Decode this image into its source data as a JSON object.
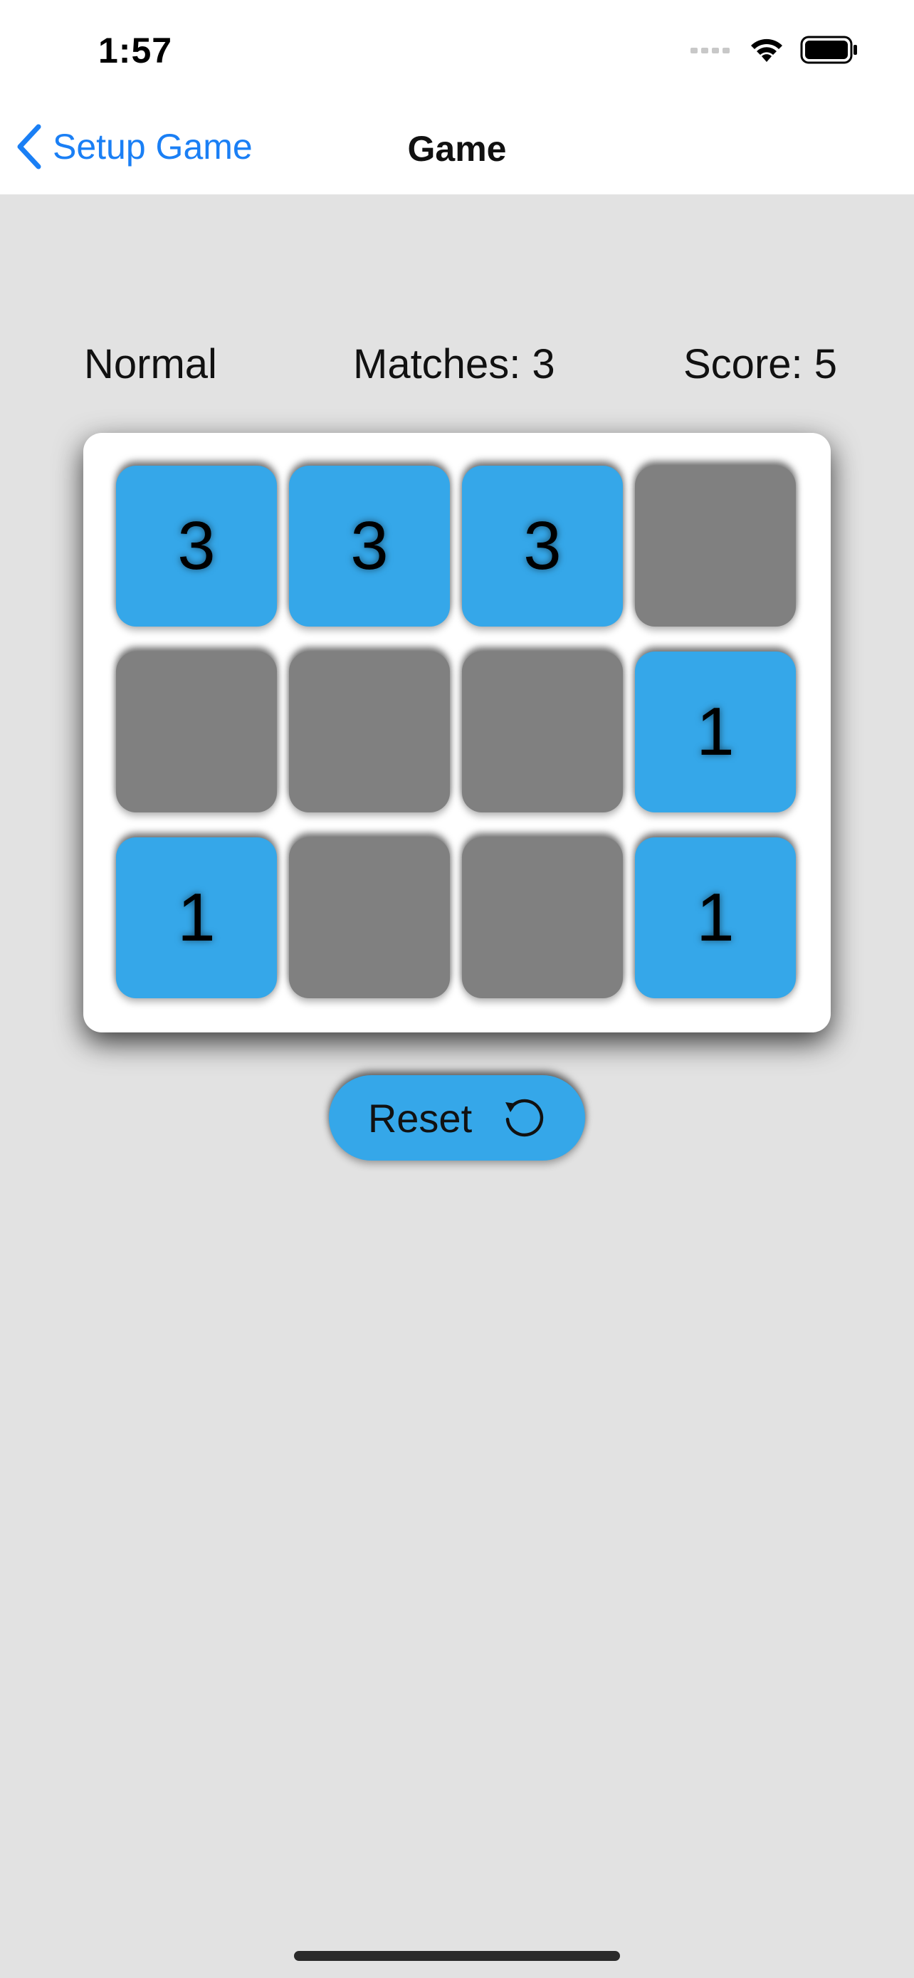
{
  "status": {
    "time": "1:57",
    "icons": [
      "cellular-icon",
      "wifi-icon",
      "battery-icon"
    ]
  },
  "nav": {
    "back_label": "Setup Game",
    "title": "Game"
  },
  "info": {
    "mode": "Normal",
    "matches": "Matches: 3",
    "score": "Score: 5"
  },
  "grid": {
    "rows": 3,
    "cols": 4,
    "tiles": [
      {
        "value": "3",
        "state": "up"
      },
      {
        "value": "3",
        "state": "up"
      },
      {
        "value": "3",
        "state": "up"
      },
      {
        "value": "",
        "state": "down"
      },
      {
        "value": "",
        "state": "down"
      },
      {
        "value": "",
        "state": "down"
      },
      {
        "value": "",
        "state": "down"
      },
      {
        "value": "1",
        "state": "up"
      },
      {
        "value": "1",
        "state": "up"
      },
      {
        "value": "",
        "state": "down"
      },
      {
        "value": "",
        "state": "down"
      },
      {
        "value": "1",
        "state": "up"
      }
    ]
  },
  "reset": {
    "label": "Reset",
    "icon": "reset-icon"
  },
  "colors": {
    "accent": "#1a7ff5",
    "tile_up": "#35a7e9",
    "tile_down": "#808080",
    "background": "#e2e2e2"
  }
}
